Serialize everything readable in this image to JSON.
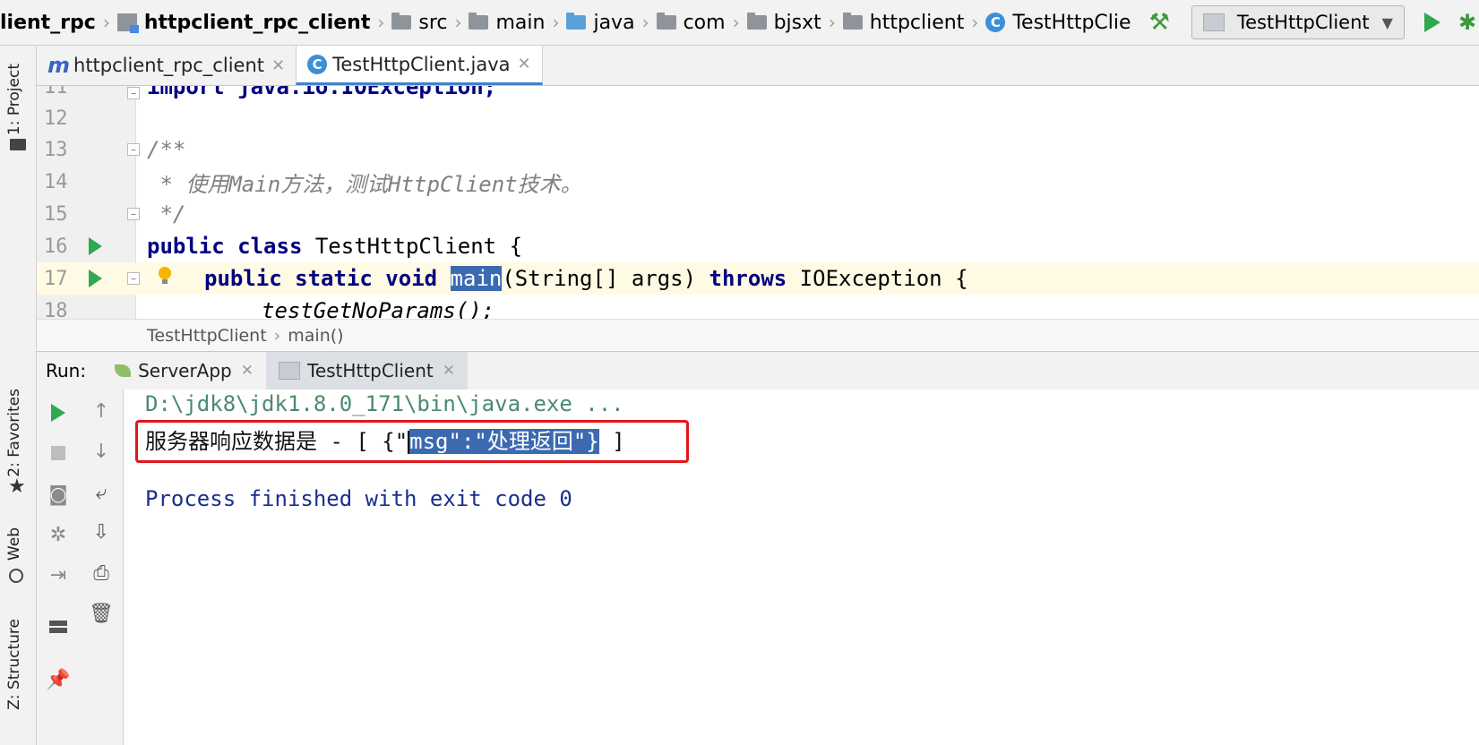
{
  "navbar": {
    "crumbs": [
      {
        "label": "lient_rpc",
        "bold": true
      },
      {
        "label": "httpclient_rpc_client",
        "bold": true
      },
      {
        "label": "src"
      },
      {
        "label": "main"
      },
      {
        "label": "java"
      },
      {
        "label": "com"
      },
      {
        "label": "bjsxt"
      },
      {
        "label": "httpclient"
      },
      {
        "label": "TestHttpClie"
      }
    ],
    "run_config": "TestHttpClient"
  },
  "left_strip": {
    "project": "1: Project",
    "favorites": "2: Favorites",
    "web": "Web",
    "structure": "Z: Structure"
  },
  "tabs": [
    {
      "label": "httpclient_rpc_client",
      "icon": "maven-m"
    },
    {
      "label": "TestHttpClient.java",
      "icon": "class-c"
    }
  ],
  "editor": {
    "lines": [
      {
        "num": "11",
        "text": "import java.io.IOException;"
      },
      {
        "num": "12",
        "text": ""
      },
      {
        "num": "13",
        "text": "/**"
      },
      {
        "num": "14",
        "text": " * 使用Main方法，测试HttpClient技术。"
      },
      {
        "num": "15",
        "text": " */"
      },
      {
        "num": "16",
        "kw1": "public class",
        "rest": " TestHttpClient {"
      },
      {
        "num": "17",
        "kw1": "public static void",
        "method": "main",
        "mid": "(String[] args) ",
        "kw2": "throws",
        "rest": " IOException {"
      },
      {
        "num": "18",
        "text": "testGetNoParams();"
      }
    ],
    "breadcrumb": [
      "TestHttpClient",
      "main()"
    ]
  },
  "run": {
    "label": "Run:",
    "tabs": [
      "ServerApp",
      "TestHttpClient"
    ],
    "console": {
      "command": "D:\\jdk8\\jdk1.8.0_171\\bin\\java.exe ...",
      "response_prefix": "服务器响应数据是 - [ {\"",
      "response_selected": "msg\":\"处理返回\"}",
      "response_suffix": " ]",
      "exit": "Process finished with exit code 0"
    }
  },
  "colors": {
    "keyword": "#000080",
    "selection": "#3b6ab0",
    "run_green": "#2fa84f",
    "annotation_red": "#e3161b"
  }
}
